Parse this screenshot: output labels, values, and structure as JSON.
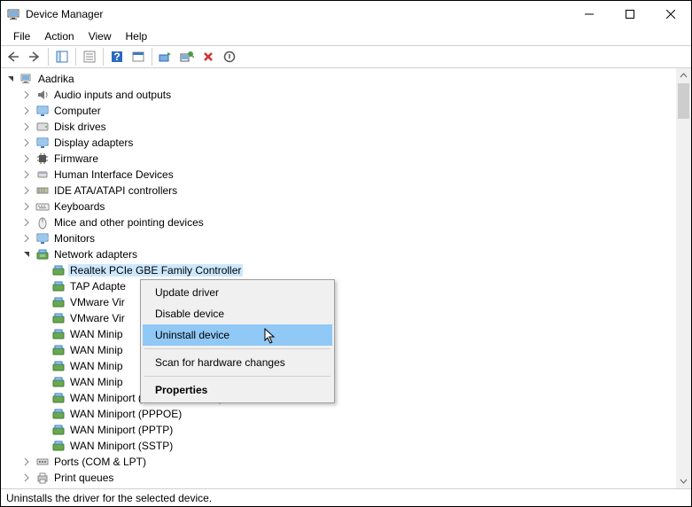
{
  "window": {
    "title": "Device Manager",
    "status": "Uninstalls the driver for the selected device."
  },
  "menu": {
    "file": "File",
    "action": "Action",
    "view": "View",
    "help": "Help"
  },
  "tree": {
    "root": "Aadrika",
    "categories": [
      {
        "label": "Audio inputs and outputs",
        "icon": "speaker",
        "expanded": false
      },
      {
        "label": "Computer",
        "icon": "monitor",
        "expanded": false
      },
      {
        "label": "Disk drives",
        "icon": "disk",
        "expanded": false
      },
      {
        "label": "Display adapters",
        "icon": "monitor",
        "expanded": false
      },
      {
        "label": "Firmware",
        "icon": "chip",
        "expanded": false
      },
      {
        "label": "Human Interface Devices",
        "icon": "hid",
        "expanded": false
      },
      {
        "label": "IDE ATA/ATAPI controllers",
        "icon": "ide",
        "expanded": false
      },
      {
        "label": "Keyboards",
        "icon": "keyboard",
        "expanded": false
      },
      {
        "label": "Mice and other pointing devices",
        "icon": "mouse",
        "expanded": false
      },
      {
        "label": "Monitors",
        "icon": "monitor",
        "expanded": false
      },
      {
        "label": "Network adapters",
        "icon": "net",
        "expanded": true,
        "children": [
          {
            "label": "Realtek PCIe GBE Family Controller",
            "selected": true
          },
          {
            "label": "TAP Adapte"
          },
          {
            "label": "VMware Vir"
          },
          {
            "label": "VMware Vir"
          },
          {
            "label": "WAN Minip"
          },
          {
            "label": "WAN Minip"
          },
          {
            "label": "WAN Minip"
          },
          {
            "label": "WAN Minip"
          },
          {
            "label": "WAN Miniport (Network Monitor)"
          },
          {
            "label": "WAN Miniport (PPPOE)"
          },
          {
            "label": "WAN Miniport (PPTP)"
          },
          {
            "label": "WAN Miniport (SSTP)"
          }
        ]
      },
      {
        "label": "Ports (COM & LPT)",
        "icon": "port",
        "expanded": false
      },
      {
        "label": "Print queues",
        "icon": "printer",
        "expanded": false
      }
    ]
  },
  "context_menu": {
    "items": [
      {
        "label": "Update driver"
      },
      {
        "label": "Disable device"
      },
      {
        "label": "Uninstall device",
        "hover": true
      },
      {
        "sep": true
      },
      {
        "label": "Scan for hardware changes"
      },
      {
        "sep": true
      },
      {
        "label": "Properties",
        "bold": true
      }
    ]
  }
}
